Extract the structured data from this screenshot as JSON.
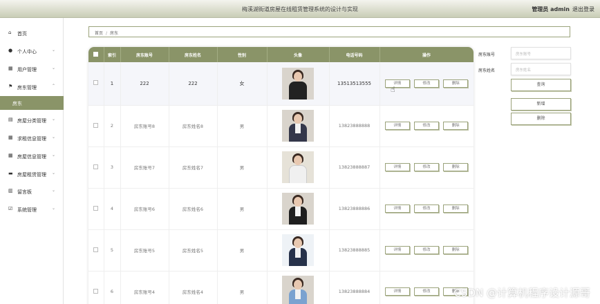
{
  "header": {
    "title": "梅溪湖街道房屋在线租赁管理系统的设计与实现",
    "user": "管理员 admin",
    "logout": "退出登录"
  },
  "sidebar": {
    "items": [
      {
        "label": "首页",
        "icon": "home-icon",
        "glyph": "⌂",
        "chevron": ""
      },
      {
        "label": "个人中心",
        "icon": "user-icon",
        "glyph": "●",
        "chevron": "⌄"
      },
      {
        "label": "用户管理",
        "icon": "grid-icon",
        "glyph": "▦",
        "chevron": "⌄"
      },
      {
        "label": "房东管理",
        "icon": "flag-icon",
        "glyph": "⚑",
        "chevron": "⌃"
      },
      {
        "label": "房东",
        "icon": "",
        "glyph": "",
        "chevron": ""
      },
      {
        "label": "房屋分类管理",
        "icon": "clipboard-icon",
        "glyph": "▤",
        "chevron": "⌄"
      },
      {
        "label": "求租信息管理",
        "icon": "grid-icon",
        "glyph": "▦",
        "chevron": "⌄"
      },
      {
        "label": "房屋信息管理",
        "icon": "grid-icon",
        "glyph": "▦",
        "chevron": "⌄"
      },
      {
        "label": "房屋租赁管理",
        "icon": "briefcase-icon",
        "glyph": "▬",
        "chevron": "⌄"
      },
      {
        "label": "留言板",
        "icon": "note-icon",
        "glyph": "▥",
        "chevron": "⌄"
      },
      {
        "label": "系统管理",
        "icon": "checkbox-icon",
        "glyph": "☑",
        "chevron": "⌄"
      }
    ]
  },
  "breadcrumb": {
    "home": "首页",
    "separator": "/",
    "current": "房东"
  },
  "table": {
    "headers": [
      "",
      "索引",
      "房东账号",
      "房东姓名",
      "性别",
      "头像",
      "电话号码",
      "操作"
    ],
    "rows": [
      {
        "index": "1",
        "account": "222",
        "name": "222",
        "gender": "女",
        "phone": "13513513555"
      },
      {
        "index": "2",
        "account": "房东账号8",
        "name": "房东姓名8",
        "gender": "男",
        "phone": "13823888888"
      },
      {
        "index": "3",
        "account": "房东账号7",
        "name": "房东姓名7",
        "gender": "男",
        "phone": "13823888887"
      },
      {
        "index": "4",
        "account": "房东账号6",
        "name": "房东姓名6",
        "gender": "男",
        "phone": "13823888886"
      },
      {
        "index": "5",
        "account": "房东账号5",
        "name": "房东姓名5",
        "gender": "男",
        "phone": "13823888885"
      },
      {
        "index": "6",
        "account": "房东账号4",
        "name": "房东姓名4",
        "gender": "男",
        "phone": "13823888884"
      }
    ],
    "actions": {
      "detail": "详情",
      "edit": "修改",
      "delete": "删除"
    }
  },
  "search": {
    "account_label": "房东账号",
    "account_placeholder": "房东账号",
    "name_label": "房东姓名",
    "name_placeholder": "房东姓名",
    "query": "查询",
    "add": "新增",
    "delete": "删除"
  },
  "watermark": "CSDN @计算机程序设计源哥",
  "colors": {
    "accent": "#8a9468",
    "header_bg": "#c9cdb6"
  }
}
